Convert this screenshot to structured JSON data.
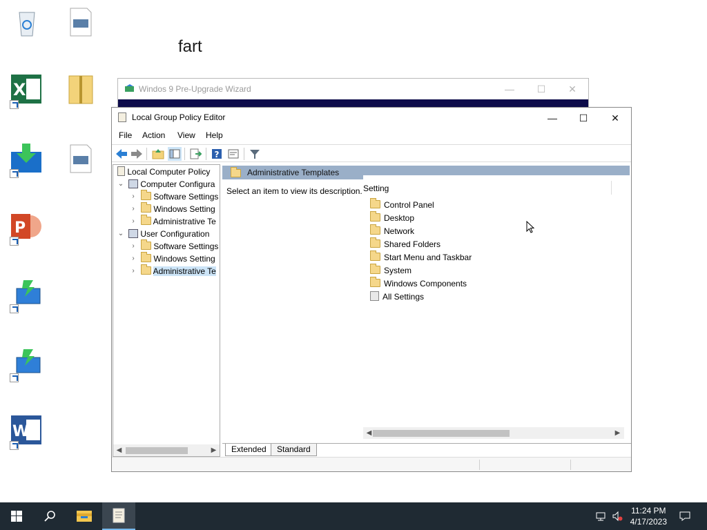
{
  "desktop": {
    "label_text": "fart",
    "icons": [
      {
        "name": "recycle-bin-icon"
      },
      {
        "name": "document-icon"
      },
      {
        "name": "excel-shortcut-icon"
      },
      {
        "name": "zip-folder-icon"
      },
      {
        "name": "download-shortcut-icon"
      },
      {
        "name": "document-icon-2"
      },
      {
        "name": "powerpoint-shortcut-icon"
      },
      {
        "name": "network-shortcut-icon"
      },
      {
        "name": "network-shortcut-icon-2"
      },
      {
        "name": "word-shortcut-icon"
      }
    ]
  },
  "wizard": {
    "title": "Windos 9 Pre-Upgrade Wizard"
  },
  "window": {
    "title": "Local Group Policy Editor",
    "menu": [
      "File",
      "Action",
      "View",
      "Help"
    ],
    "tree": [
      {
        "label": "Local Computer Policy",
        "level": 0
      },
      {
        "label": "Computer Configura",
        "level": 1
      },
      {
        "label": "Software Settings",
        "level": 2
      },
      {
        "label": "Windows Setting",
        "level": 2
      },
      {
        "label": "Administrative Te",
        "level": 2
      },
      {
        "label": "User Configuration",
        "level": 1
      },
      {
        "label": "Software Settings",
        "level": 2
      },
      {
        "label": "Windows Setting",
        "level": 2
      },
      {
        "label": "Administrative Te",
        "level": 2
      }
    ],
    "pane_header": "Administrative Templates",
    "description": "Select an item to view its description.",
    "column_header": "Setting",
    "items": [
      "Control Panel",
      "Desktop",
      "Network",
      "Shared Folders",
      "Start Menu and Taskbar",
      "System",
      "Windows Components",
      "All Settings"
    ],
    "tabs": [
      "Extended",
      "Standard"
    ]
  },
  "taskbar": {
    "time": "11:24 PM",
    "date": "4/17/2023"
  },
  "colors": {
    "taskbar": "#1f2a33",
    "pane_header": "#9aafc8",
    "selected": "#cce4f7"
  }
}
